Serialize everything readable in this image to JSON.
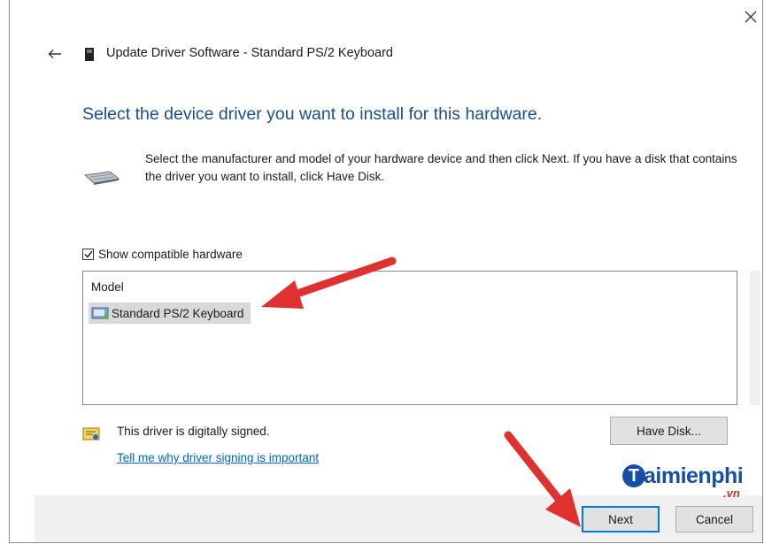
{
  "window": {
    "title": "Update Driver Software - Standard PS/2 Keyboard",
    "heading": "Select the device driver you want to install for this hardware.",
    "instructions": "Select the manufacturer and model of your hardware device and then click Next. If you have a disk that contains the driver you want to install, click Have Disk."
  },
  "compatible": {
    "label": "Show compatible hardware",
    "checked": true
  },
  "model_list": {
    "header": "Model",
    "items": [
      {
        "label": "Standard PS/2 Keyboard",
        "selected": true
      }
    ]
  },
  "signing": {
    "status": "This driver is digitally signed.",
    "link": "Tell me why driver signing is important"
  },
  "buttons": {
    "have_disk": "Have Disk...",
    "next": "Next",
    "cancel": "Cancel"
  },
  "watermark": {
    "brand_initial": "T",
    "brand": "aimienphi",
    "suffix": ".vn"
  },
  "colors": {
    "heading": "#1a4f8a",
    "link": "#0066cc",
    "focus_border": "#0078d7",
    "annotation_arrow": "#e03131"
  },
  "icons": [
    "close-icon",
    "back-arrow-icon",
    "device-icon",
    "keyboard-icon",
    "checkbox-check-icon",
    "driver-package-icon",
    "certificate-icon"
  ]
}
